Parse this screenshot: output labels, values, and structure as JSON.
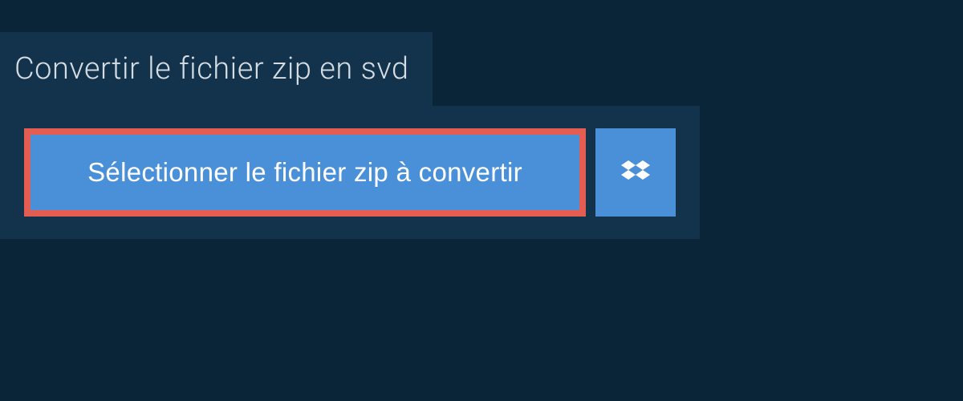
{
  "header": {
    "title": "Convertir le fichier zip en svd"
  },
  "main": {
    "select_button_label": "Sélectionner le fichier zip à convertir"
  }
}
